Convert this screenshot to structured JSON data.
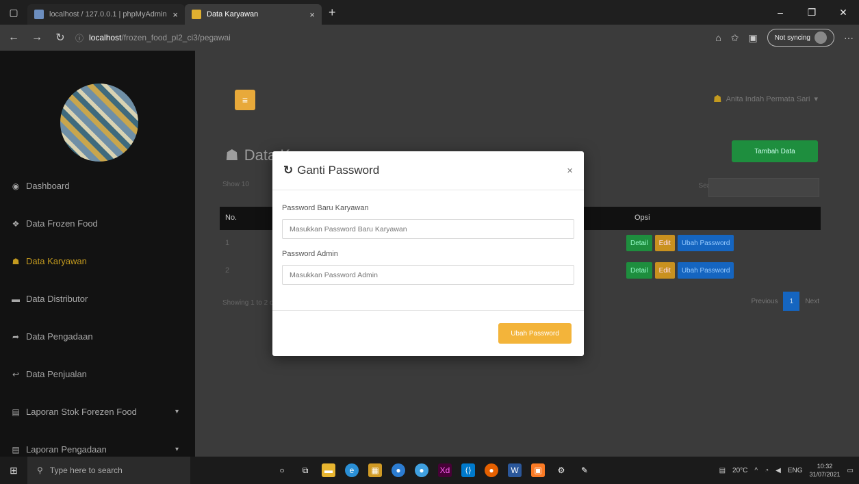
{
  "browser": {
    "tabs": [
      {
        "title": "localhost / 127.0.0.1 | phpMyAdmin",
        "active": false
      },
      {
        "title": "Data Karyawan",
        "active": true
      }
    ],
    "url_host": "localhost",
    "url_path": "/frozen_food_pl2_ci3/pegawai",
    "sync_label": "Not syncing"
  },
  "sidebar": {
    "items": [
      {
        "label": "Dashboard",
        "icon": "dashboard-icon"
      },
      {
        "label": "Data Frozen Food",
        "icon": "cubes-icon"
      },
      {
        "label": "Data Karyawan",
        "icon": "users-icon",
        "active": true
      },
      {
        "label": "Data Distributor",
        "icon": "truck-icon"
      },
      {
        "label": "Data Pengadaan",
        "icon": "share-icon"
      },
      {
        "label": "Data Penjualan",
        "icon": "reply-icon"
      },
      {
        "label": "Laporan Stok Forezen Food",
        "icon": "file-icon",
        "caret": true
      },
      {
        "label": "Laporan Pengadaan",
        "icon": "file-icon",
        "caret": true
      }
    ]
  },
  "header": {
    "user_name": "Anita Indah Permata Sari"
  },
  "page": {
    "heading": "Data Karyawan",
    "add_button": "Tambah Data",
    "show_label": "Show 10",
    "search_label": "Search:",
    "columns": {
      "no": "No.",
      "opsi": "Opsi"
    },
    "rows": [
      {
        "no": "1"
      },
      {
        "no": "2"
      }
    ],
    "row_buttons": {
      "detail": "Detail",
      "edit": "Edit",
      "ubah": "Ubah Password"
    },
    "showing_text": "Showing 1 to 2 of 2 entries",
    "pager": {
      "prev": "Previous",
      "current": "1",
      "next": "Next"
    }
  },
  "modal": {
    "title": "Ganti Password",
    "close": "×",
    "field1_label": "Password Baru Karyawan",
    "field1_placeholder": "Masukkan Password Baru Karyawan",
    "field2_label": "Password Admin",
    "field2_placeholder": "Masukkan Password Admin",
    "submit": "Ubah Password"
  },
  "taskbar": {
    "search_placeholder": "Type here to search",
    "weather": "20°C",
    "language": "ENG",
    "time": "10:32",
    "date": "31/07/2021"
  }
}
